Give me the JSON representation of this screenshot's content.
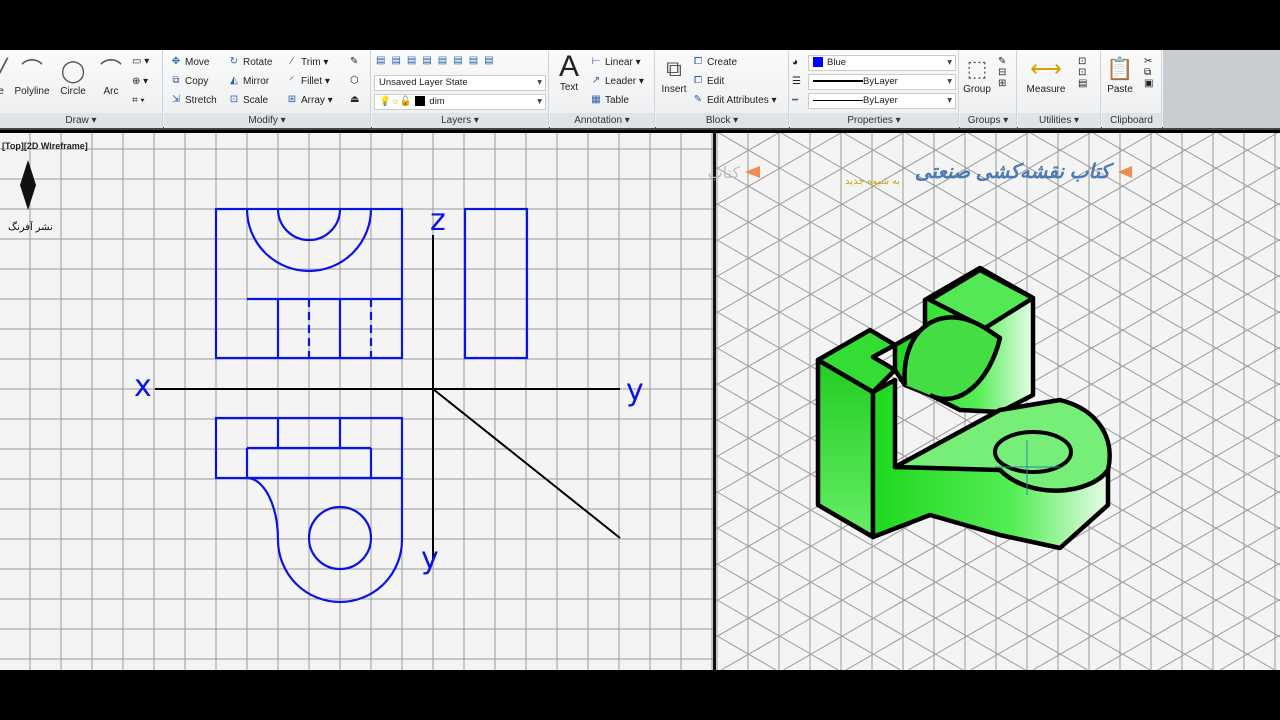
{
  "ribbon": {
    "draw": {
      "title": "Draw ▾",
      "items": [
        "Polyline",
        "Circle",
        "Arc"
      ]
    },
    "modify": {
      "title": "Modify ▾",
      "items": [
        "Move",
        "Rotate",
        "Trim ▾",
        "Copy",
        "Mirror",
        "Fillet ▾",
        "Stretch",
        "Scale",
        "Array ▾"
      ]
    },
    "layers": {
      "title": "Layers ▾",
      "layer_state": "Unsaved Layer State",
      "current_layer": "dim"
    },
    "annotation": {
      "title": "Annotation ▾",
      "text": "Text",
      "items": [
        "Linear ▾",
        "Leader ▾",
        "Table"
      ]
    },
    "block": {
      "title": "Block ▾",
      "insert": "Insert",
      "items": [
        "Create",
        "Edit",
        "Edit Attributes ▾"
      ]
    },
    "properties": {
      "title": "Properties ▾",
      "color": "Blue",
      "color_hex": "#0000ff",
      "lineweight": "ByLayer",
      "linetype": "ByLayer"
    },
    "groups": {
      "title": "Groups ▾",
      "group": "Group"
    },
    "utilities": {
      "title": "Utilities ▾",
      "measure": "Measure"
    },
    "clipboard": {
      "title": "Clipboard",
      "paste": "Paste"
    }
  },
  "viewport": {
    "label": "[Top][2D Wireframe]",
    "axis_labels": {
      "x": "x",
      "y_right": "y",
      "z": "z",
      "y_bottom": "y"
    }
  },
  "watermark": {
    "title": "کتاب نقشه‌کشی صنعتی",
    "subtitle": "به شیوه جدید"
  },
  "colors": {
    "drawing": "#0a14e6",
    "solid": "#22dd22",
    "grid": "#9a9a9a"
  }
}
